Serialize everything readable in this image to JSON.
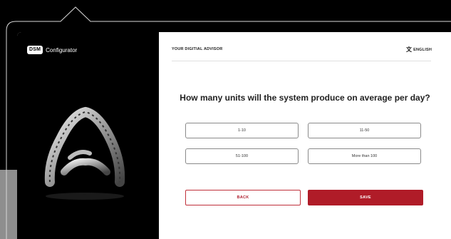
{
  "app": {
    "logo_badge": "DSM",
    "logo_text": "Configurator"
  },
  "header": {
    "advisor_label": "YOUR DIGITIAL ADVISOR",
    "language": "ENGLISH",
    "language_icon": "translate-icon"
  },
  "question": "How many units will the system produce on average per day?",
  "options": [
    {
      "label": "1-10"
    },
    {
      "label": "11-50"
    },
    {
      "label": "51-100"
    },
    {
      "label": "More than 100"
    }
  ],
  "actions": {
    "back_label": "BACK",
    "save_label": "SAVE"
  },
  "colors": {
    "accent": "#b01c28",
    "background": "#000000",
    "band": "#8e8e8e"
  }
}
